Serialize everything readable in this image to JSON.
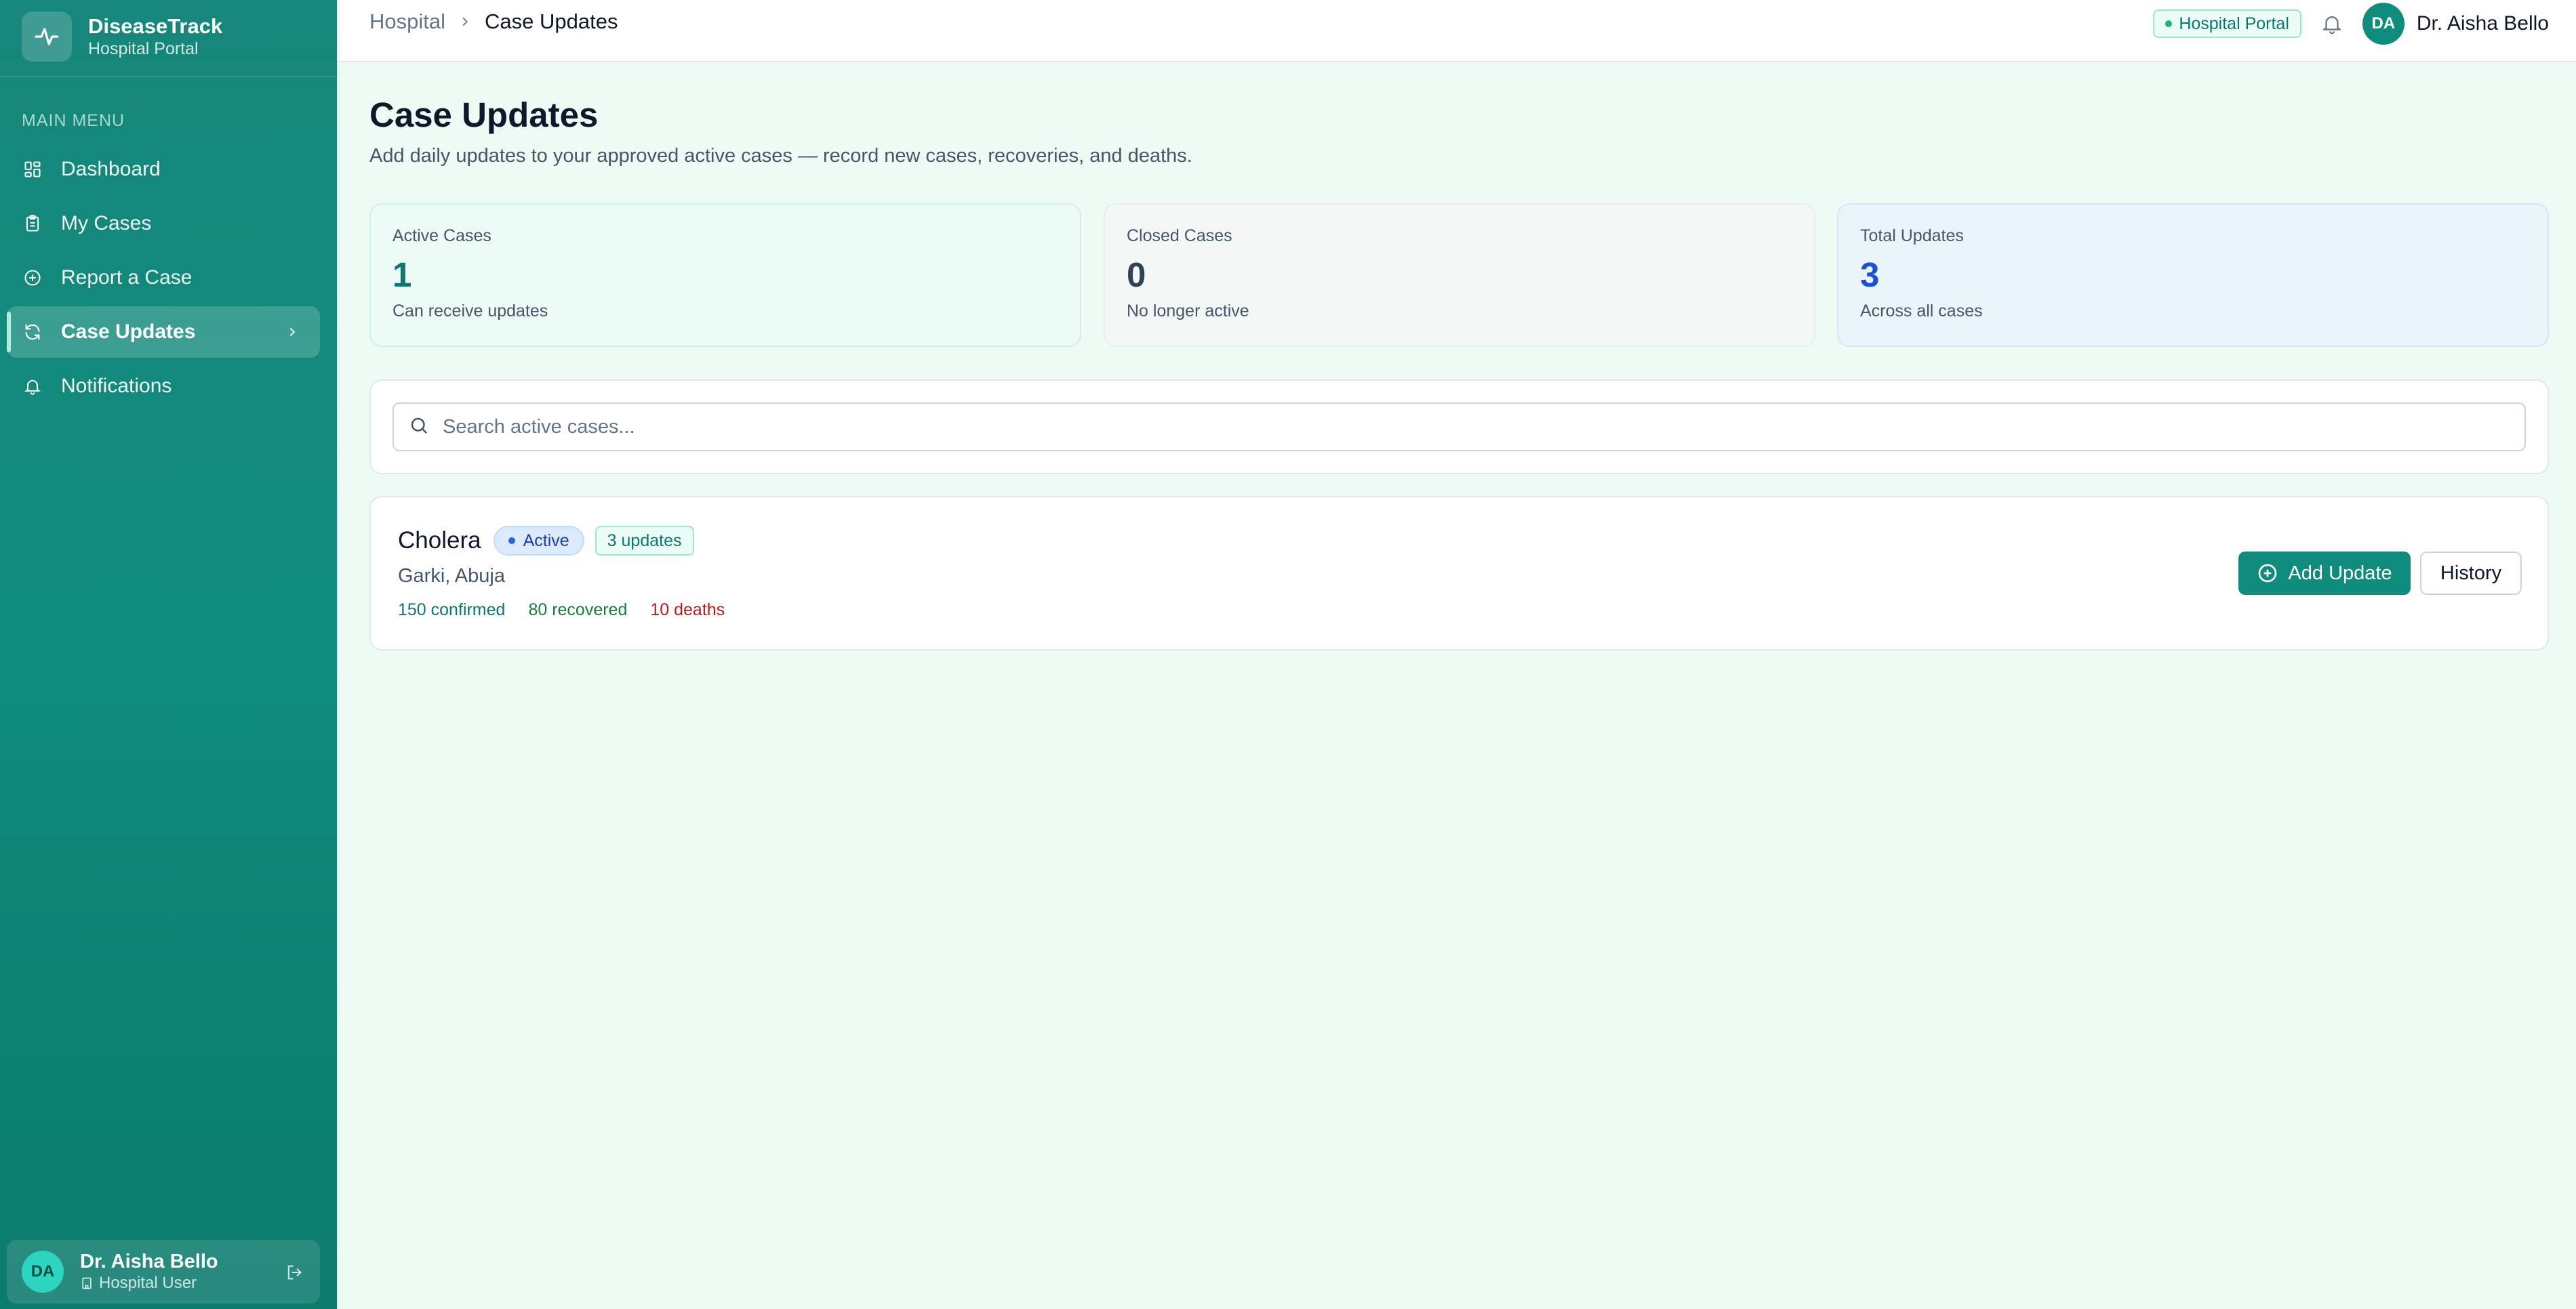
{
  "app": {
    "name": "DiseaseTrack",
    "portal": "Hospital Portal"
  },
  "sidebar": {
    "menu_label": "MAIN MENU",
    "items": [
      {
        "label": "Dashboard",
        "icon": "grid-icon"
      },
      {
        "label": "My Cases",
        "icon": "clipboard-icon"
      },
      {
        "label": "Report a Case",
        "icon": "plus-circle-icon"
      },
      {
        "label": "Case Updates",
        "icon": "refresh-icon",
        "active": true
      },
      {
        "label": "Notifications",
        "icon": "bell-icon"
      }
    ],
    "user": {
      "initials": "DA",
      "name": "Dr. Aisha Bello",
      "role": "Hospital User"
    }
  },
  "topbar": {
    "breadcrumb": [
      "Hospital",
      "Case Updates"
    ],
    "portal_badge": "Hospital Portal",
    "user_initials": "DA",
    "user_name": "Dr. Aisha Bello"
  },
  "page": {
    "title": "Case Updates",
    "subtitle": "Add daily updates to your approved active cases — record new cases, recoveries, and deaths."
  },
  "stats": [
    {
      "label": "Active Cases",
      "value": "1",
      "note": "Can receive updates"
    },
    {
      "label": "Closed Cases",
      "value": "0",
      "note": "No longer active"
    },
    {
      "label": "Total Updates",
      "value": "3",
      "note": "Across all cases"
    }
  ],
  "search": {
    "placeholder": "Search active cases..."
  },
  "cases": [
    {
      "disease": "Cholera",
      "status": "Active",
      "updates": "3 updates",
      "location": "Garki, Abuja",
      "confirmed": "150 confirmed",
      "recovered": "80 recovered",
      "deaths": "10 deaths",
      "add_label": "Add Update",
      "history_label": "History"
    }
  ],
  "colors": {
    "brand": "#0f8c7c",
    "confirmed": "#0f766e",
    "recovered": "#15803d",
    "deaths": "#b91c1c",
    "active_badge": "#1e40af"
  }
}
